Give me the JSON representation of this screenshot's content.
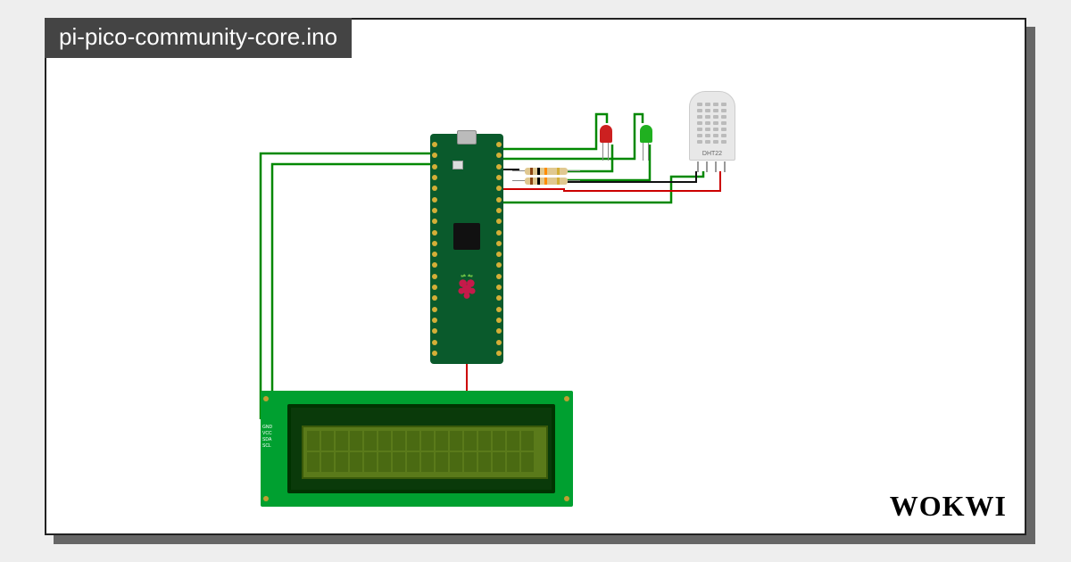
{
  "title": "pi-pico-community-core.ino",
  "logo": "WOKWI",
  "components": {
    "board": "Raspberry Pi Pico",
    "sensor": "DHT22",
    "display": "LCD 1602 I2C",
    "leds": [
      "red",
      "green"
    ],
    "resistors": 2
  },
  "lcd_labels": {
    "gnd": "GND",
    "vcc": "VCC",
    "sda": "SDA",
    "scl": "SCL"
  },
  "sensor_label": "DHT22",
  "colors": {
    "wire_green": "#008800",
    "wire_red": "#cc0000",
    "wire_black": "#111111",
    "pcb": "#0a5a2c"
  }
}
